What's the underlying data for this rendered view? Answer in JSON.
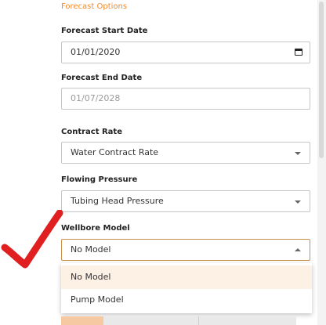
{
  "section_title": "Forecast Options",
  "forecast_start": {
    "label": "Forecast Start Date",
    "value": "01/01/2020"
  },
  "forecast_end": {
    "label": "Forecast End Date",
    "value": "01/07/2028"
  },
  "contract_rate": {
    "label": "Contract Rate",
    "value": "Water Contract Rate"
  },
  "flowing_pressure": {
    "label": "Flowing Pressure",
    "value": "Tubing Head Pressure"
  },
  "wellbore_model": {
    "label": "Wellbore Model",
    "value": "No Model",
    "options": [
      "No Model",
      "Pump Model"
    ]
  },
  "colors": {
    "accent": "#f08a2a",
    "annotation_mark": "#e02020",
    "selected_option_bg": "#fdf1e6"
  },
  "icons": {
    "date_picker": "calendar-icon",
    "select_closed": "caret-down-icon",
    "select_open": "caret-up-icon",
    "annotation": "check-mark-annotation"
  }
}
